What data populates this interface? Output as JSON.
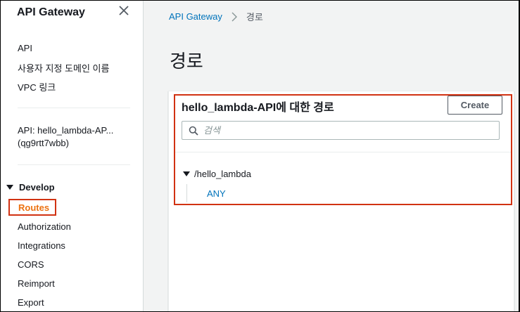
{
  "sidebar": {
    "title": "API Gateway",
    "links": [
      "API",
      "사용자 지정 도메인 이름",
      "VPC 링크"
    ],
    "api_name_line1": "API: hello_lambda-AP...",
    "api_name_line2": "(qg9rtt7wbb)",
    "section_label": "Develop",
    "section_items": [
      "Routes",
      "Authorization",
      "Integrations",
      "CORS",
      "Reimport",
      "Export"
    ],
    "active_item": "Routes",
    "close_icon": "close-icon"
  },
  "breadcrumb": {
    "root": "API Gateway",
    "current": "경로"
  },
  "page": {
    "title": "경로"
  },
  "panel": {
    "title": "hello_lambda-API에 대한 경로",
    "create_label": "Create",
    "search_placeholder": "검색",
    "search_value": ""
  },
  "routes": [
    {
      "path": "/hello_lambda",
      "expanded": true,
      "methods": [
        "ANY"
      ]
    }
  ],
  "colors": {
    "accent_orange": "#ec7211",
    "highlight_red": "#d13212",
    "link_blue": "#0073bb",
    "text_dark": "#16191f",
    "background": "#f2f3f3"
  }
}
